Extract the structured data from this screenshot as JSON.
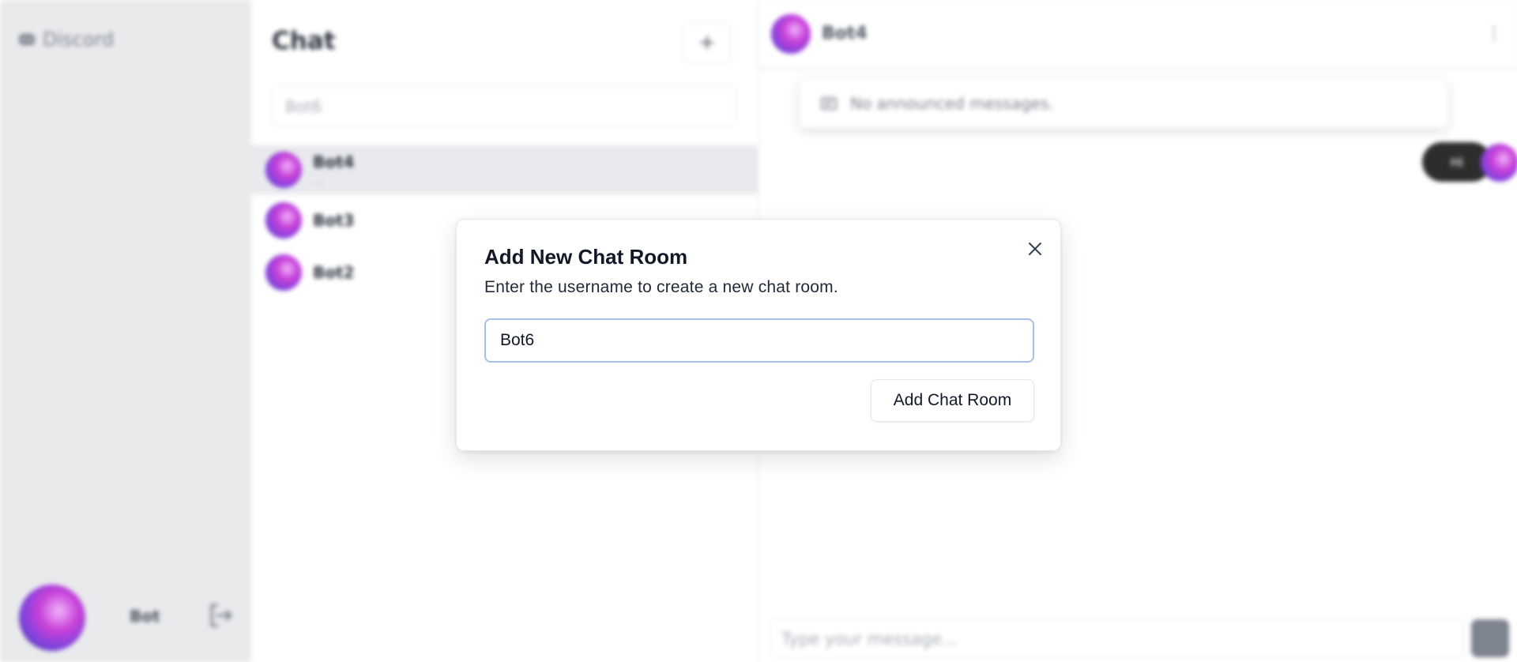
{
  "app": {
    "brand_name": "Discord",
    "current_user": {
      "name": "Bot"
    }
  },
  "chat_list": {
    "title": "Chat",
    "add_button_label": "+",
    "search_value": "Bot6",
    "rooms": [
      {
        "name": "Bot4",
        "preview": "…",
        "active": true
      },
      {
        "name": "Bot3",
        "preview": "",
        "active": false
      },
      {
        "name": "Bot2",
        "preview": "",
        "active": false
      }
    ]
  },
  "conversation": {
    "partner_name": "Bot4",
    "menu_glyph": "⋮",
    "pinned_text": "No announced messages.",
    "message_bubble": "Hi",
    "input_placeholder": "Type your message..."
  },
  "modal": {
    "title": "Add New Chat Room",
    "description": "Enter the username to create a new chat room.",
    "input_value": "Bot6",
    "submit_label": "Add Chat Room",
    "close_icon": "close-icon"
  },
  "colors": {
    "input_focus_border": "#a5c1e8",
    "sidebar_bg": "#e6e7ea",
    "active_room_bg": "#e5e7eb"
  }
}
